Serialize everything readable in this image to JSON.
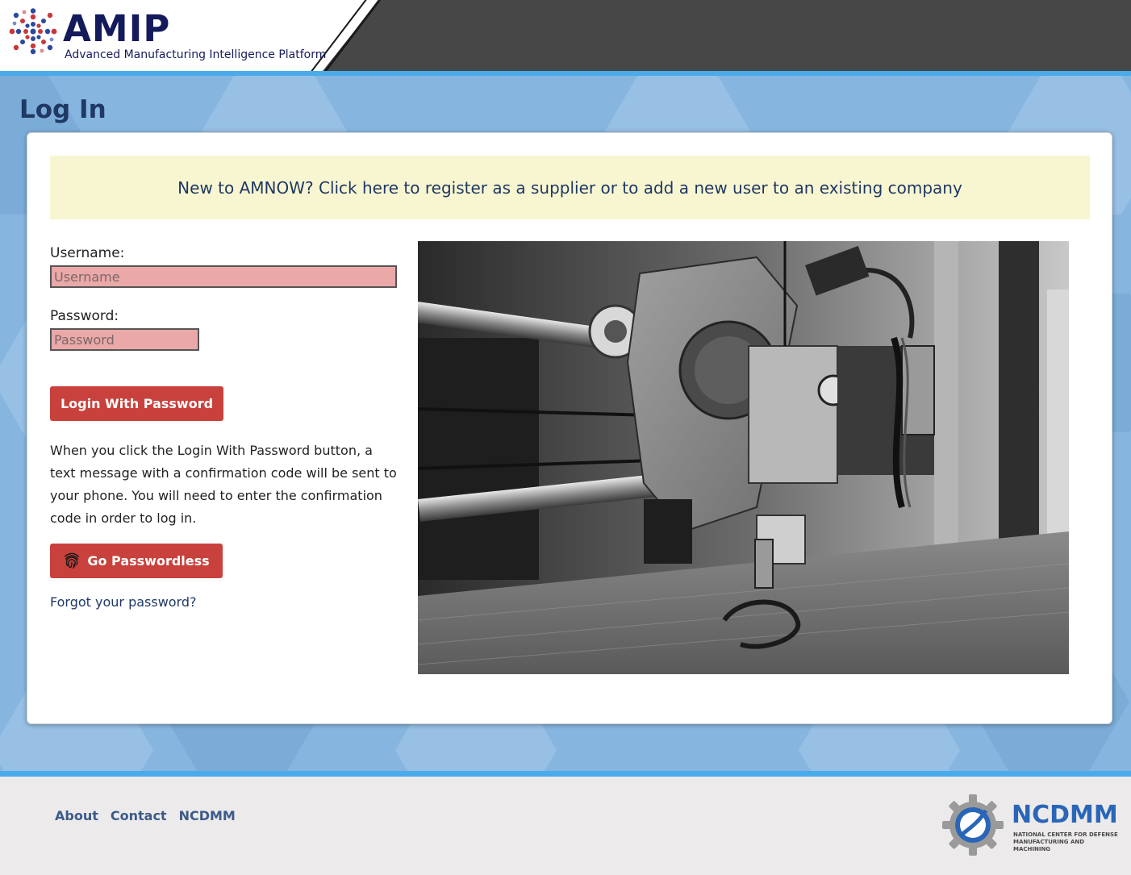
{
  "header": {
    "logo_title": "AMIP",
    "logo_subtitle": "Advanced Manufacturing Intelligence Platform",
    "colors": {
      "bar": "#474747",
      "stripe": "#4aabeb",
      "brand": "#141b5c"
    }
  },
  "page": {
    "title": "Log In",
    "background_color": "#86b6e0"
  },
  "register_banner": {
    "text": "New to AMNOW? Click here to register as a supplier or to add a new user to an existing company"
  },
  "form": {
    "username_label": "Username:",
    "username_placeholder": "Username",
    "username_value": "",
    "password_label": "Password:",
    "password_placeholder": "Password",
    "password_value": "",
    "login_button_label": "Login With Password",
    "help_text": "When you click the Login With Password button, a text message with a confirmation code will be sent to your phone. You will need to enter the confirmation code in order to log in.",
    "passwordless_button_label": "Go Passwordless",
    "passwordless_icon": "fingerprint-icon",
    "forgot_link_label": "Forgot your password?",
    "button_color": "#c9413c",
    "input_error_color": "#eba8a8"
  },
  "photo": {
    "subject": "3d-printer-extruder-photo"
  },
  "footer": {
    "links": [
      "About",
      "Contact",
      "NCDMM"
    ],
    "logo_name": "NCDMM",
    "logo_tagline_line1": "NATIONAL CENTER FOR DEFENSE",
    "logo_tagline_line2": "MANUFACTURING AND MACHINING"
  }
}
